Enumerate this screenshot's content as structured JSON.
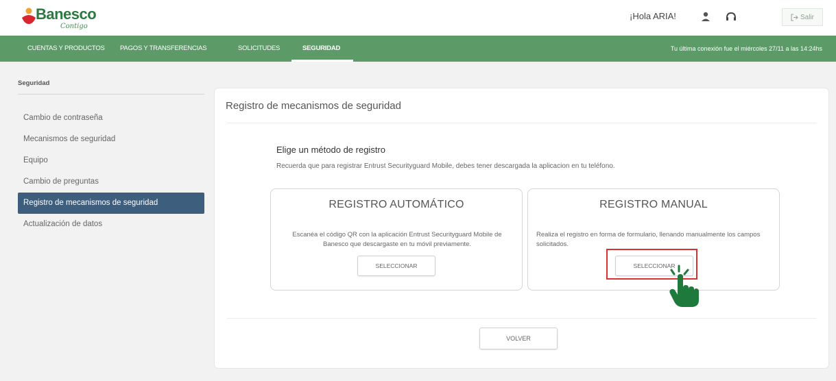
{
  "colors": {
    "brand_green": "#2a7a3f",
    "nav_green": "#5c9a68",
    "sidebar_active": "#3e5e7e",
    "logo_red": "#d7262e",
    "logo_orange": "#f0a431",
    "highlight_red": "#d93030",
    "hand_green": "#1e7a3c"
  },
  "header": {
    "logo_text": "Banesco",
    "logo_subtext": "Contigo",
    "greeting": "¡Hola ARIA!",
    "user_icon": "user-icon",
    "support_icon": "headset-icon",
    "logout_label": "Salir"
  },
  "nav": {
    "items": [
      {
        "label": "CUENTAS Y PRODUCTOS"
      },
      {
        "label": "PAGOS Y TRANSFERENCIAS"
      },
      {
        "label": "SOLICITUDES"
      },
      {
        "label": "SEGURIDAD",
        "active": true
      }
    ],
    "last_login": "Tu última conexión fue el miércoles 27/11 a las 14:24hs"
  },
  "sidebar": {
    "heading": "Seguridad",
    "items": [
      {
        "label": "Cambio de contraseña"
      },
      {
        "label": "Mecanismos de seguridad"
      },
      {
        "label": "Equipo"
      },
      {
        "label": "Cambio de preguntas"
      },
      {
        "label": "Registro de mecanismos de seguridad",
        "active": true
      },
      {
        "label": "Actualización de datos"
      }
    ]
  },
  "main": {
    "title": "Registro de mecanismos de seguridad",
    "method_title": "Elige un método de registro",
    "method_note": "Recuerda que para registrar Entrust Securityguard Mobile, debes tener descargada la aplicacion en tu teléfono.",
    "options": [
      {
        "title": "REGISTRO AUTOMÁTICO",
        "description": "Escanéa el código QR con la aplicación Entrust Securityguard Mobile de Banesco que descargaste en tu móvil previamente.",
        "button": "SELECCIONAR"
      },
      {
        "title": "REGISTRO MANUAL",
        "description": "Realiza el registro en forma de formulario, llenando manualmente los campos solicitados.",
        "button": "SELECCIONAR"
      }
    ],
    "back_button": "VOLVER"
  }
}
